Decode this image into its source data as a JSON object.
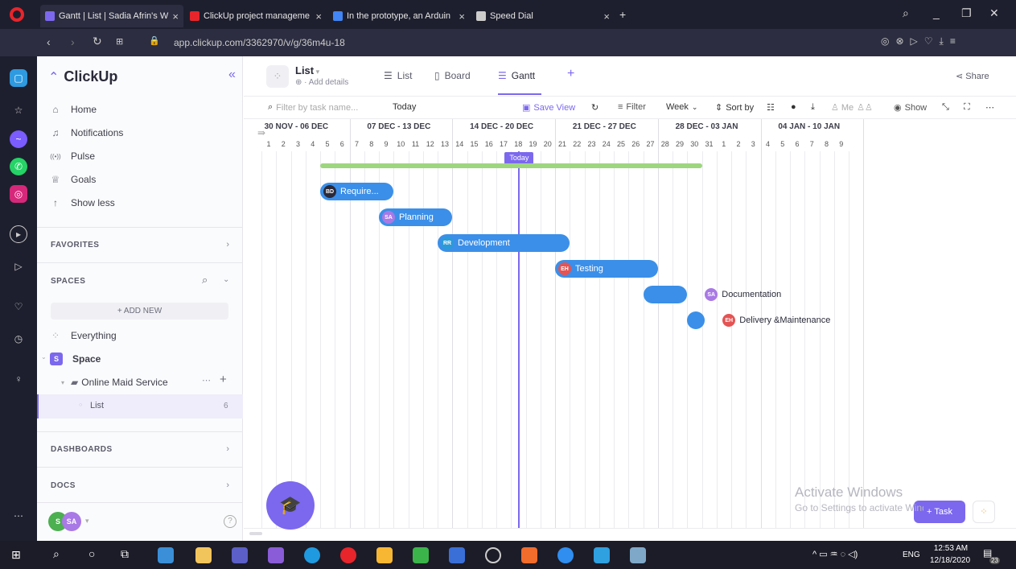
{
  "browser": {
    "tabs": [
      {
        "title": "Gantt | List | Sadia Afrin's W",
        "active": true,
        "color": "#7b68ee"
      },
      {
        "title": "ClickUp project manageme",
        "active": false,
        "color": "#e8252b"
      },
      {
        "title": "In the prototype, an Arduin",
        "active": false,
        "color": "#4285f4"
      },
      {
        "title": "Speed Dial",
        "active": false,
        "color": "#cccccc"
      }
    ],
    "url": "app.clickup.com/3362970/v/g/36m4u-18"
  },
  "sidebar": {
    "logo": "ClickUp",
    "collapse_icon": "«",
    "nav": [
      {
        "label": "Home",
        "icon": "home-icon",
        "glyph": "⌂"
      },
      {
        "label": "Notifications",
        "icon": "bell-icon",
        "glyph": "♫"
      },
      {
        "label": "Pulse",
        "icon": "pulse-icon",
        "glyph": "((•))"
      },
      {
        "label": "Goals",
        "icon": "trophy-icon",
        "glyph": "♕"
      },
      {
        "label": "Show less",
        "icon": "arrow-up-icon",
        "glyph": "↑"
      }
    ],
    "favorites": "FAVORITES",
    "spaces": "SPACES",
    "add_new": "+ ADD NEW",
    "everything": "Everything",
    "space": {
      "badge": "S",
      "label": "Space"
    },
    "folder": "Online Maid Service",
    "list": {
      "label": "List",
      "count": "6"
    },
    "dashboards": "DASHBOARDS",
    "docs": "DOCS",
    "user_avatars": [
      "S",
      "SA"
    ]
  },
  "viewbar": {
    "list_title": "List",
    "add_details": "Add details",
    "views": [
      "List",
      "Board",
      "Gantt"
    ],
    "share": "Share"
  },
  "toolbar": {
    "filter_placeholder": "Filter by task name...",
    "today": "Today",
    "save_view": "Save View",
    "filter": "Filter",
    "week": "Week",
    "sort_by": "Sort by",
    "me": "Me",
    "show": "Show"
  },
  "gantt": {
    "weeks": [
      "30 NOV - 06 DEC",
      "07 DEC - 13 DEC",
      "14 DEC - 20 DEC",
      "21 DEC - 27 DEC",
      "28 DEC - 03 JAN",
      "04 JAN - 10 JAN"
    ],
    "days": [
      "1",
      "2",
      "3",
      "4",
      "5",
      "6",
      "7",
      "8",
      "9",
      "10",
      "11",
      "12",
      "13",
      "14",
      "15",
      "16",
      "17",
      "18",
      "19",
      "20",
      "21",
      "22",
      "23",
      "24",
      "25",
      "26",
      "27",
      "28",
      "29",
      "30",
      "31",
      "1",
      "2",
      "3",
      "4",
      "5",
      "6",
      "7",
      "8",
      "9"
    ],
    "today_label": "Today",
    "today_day_index": 17,
    "summary": {
      "start": 4,
      "end": 30,
      "color": "#9ed67f"
    },
    "tasks": [
      {
        "name": "Require...",
        "initials": "BD",
        "avatar_color": "#2a2a3a",
        "start": 4,
        "end": 9,
        "label_inside": true
      },
      {
        "name": "Planning",
        "initials": "SA",
        "avatar_color": "#a979e6",
        "start": 8,
        "end": 13,
        "label_inside": true
      },
      {
        "name": "Development",
        "initials": "RR",
        "avatar_color": "#2b9bd8",
        "start": 12,
        "end": 21,
        "label_inside": true
      },
      {
        "name": "Testing",
        "initials": "EH",
        "avatar_color": "#e55353",
        "start": 20,
        "end": 27,
        "label_inside": true
      },
      {
        "name": "Documentation",
        "initials": "SA",
        "avatar_color": "#a979e6",
        "start": 26,
        "end": 29,
        "label_inside": false
      },
      {
        "name": "Delivery &Maintenance",
        "initials": "EH",
        "avatar_color": "#e55353",
        "start": 29,
        "end": 30,
        "label_inside": false
      }
    ],
    "add_task": "+ Task"
  },
  "watermark": {
    "line1": "Activate Windows",
    "line2": "Go to Settings to activate Windows."
  },
  "taskbar": {
    "time": "12:53 AM",
    "date": "12/18/2020",
    "lang": "ENG",
    "notif_count": "23"
  }
}
